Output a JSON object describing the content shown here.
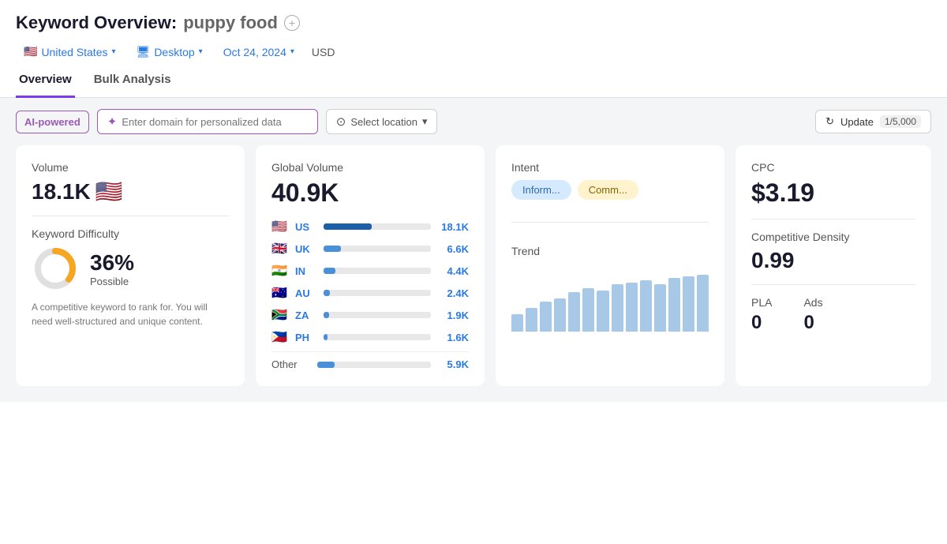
{
  "header": {
    "title_prefix": "Keyword Overview:",
    "title_query": "puppy food",
    "add_icon": "+",
    "filters": {
      "location": "United States",
      "device": "Desktop",
      "date": "Oct 24, 2024",
      "currency": "USD"
    }
  },
  "tabs": [
    {
      "id": "overview",
      "label": "Overview",
      "active": true
    },
    {
      "id": "bulk",
      "label": "Bulk Analysis",
      "active": false
    }
  ],
  "toolbar": {
    "ai_badge": "AI-powered",
    "domain_placeholder": "Enter domain for personalized data",
    "sparkle": "✦",
    "location_placeholder": "Select location",
    "location_icon": "⊙",
    "update_label": "Update",
    "update_count": "1/5,000",
    "refresh_icon": "↻",
    "caret": "∨"
  },
  "cards": {
    "volume": {
      "label": "Volume",
      "value": "18.1K",
      "flag": "🇺🇸",
      "kd_label": "Keyword Difficulty",
      "kd_percent": "36%",
      "kd_sublabel": "Possible",
      "kd_description": "A competitive keyword to rank for. You will need well-structured and unique content.",
      "donut": {
        "percent": 36,
        "color_filled": "#f5a623",
        "color_empty": "#e0e0e0",
        "size": 60,
        "stroke_width": 8
      }
    },
    "global_volume": {
      "label": "Global Volume",
      "value": "40.9K",
      "countries": [
        {
          "flag": "🇺🇸",
          "code": "US",
          "bar_pct": 45,
          "dark": true,
          "value": "18.1K"
        },
        {
          "flag": "🇬🇧",
          "code": "UK",
          "bar_pct": 16,
          "dark": false,
          "value": "6.6K"
        },
        {
          "flag": "🇮🇳",
          "code": "IN",
          "bar_pct": 11,
          "dark": false,
          "value": "4.4K"
        },
        {
          "flag": "🇦🇺",
          "code": "AU",
          "bar_pct": 6,
          "dark": false,
          "value": "2.4K"
        },
        {
          "flag": "🇿🇦",
          "code": "ZA",
          "bar_pct": 5,
          "dark": false,
          "value": "1.9K"
        },
        {
          "flag": "🇵🇭",
          "code": "PH",
          "bar_pct": 4,
          "dark": false,
          "value": "1.6K"
        }
      ],
      "other_label": "Other",
      "other_bar_pct": 15,
      "other_value": "5.9K"
    },
    "intent": {
      "label": "Intent",
      "badges": [
        {
          "text": "Inform...",
          "style": "blue"
        },
        {
          "text": "Comm...",
          "style": "yellow"
        }
      ],
      "trend_label": "Trend",
      "trend_bars": [
        22,
        30,
        38,
        42,
        50,
        55,
        52,
        60,
        62,
        65,
        60,
        68,
        70,
        72
      ]
    },
    "cpc": {
      "label": "CPC",
      "value": "$3.19",
      "comp_label": "Competitive Density",
      "comp_value": "0.99",
      "pla_label": "PLA",
      "pla_value": "0",
      "ads_label": "Ads",
      "ads_value": "0"
    }
  }
}
